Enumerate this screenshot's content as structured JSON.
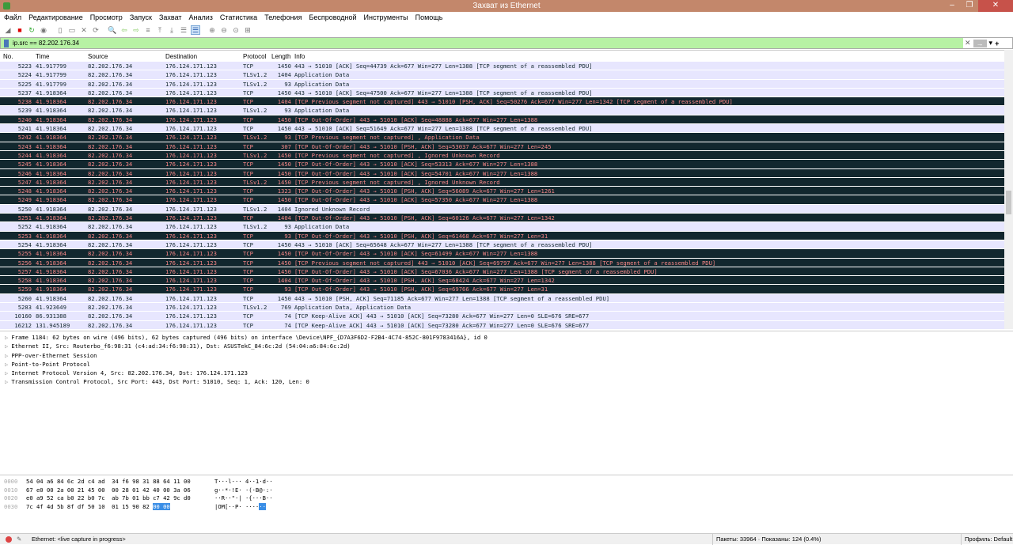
{
  "window": {
    "title": "Захват из Ethernet",
    "minimize": "–",
    "maximize": "❐",
    "close": "✕"
  },
  "menu": [
    "Файл",
    "Редактирование",
    "Просмотр",
    "Запуск",
    "Захват",
    "Анализ",
    "Статистика",
    "Телефония",
    "Беспроводной",
    "Инструменты",
    "Помощь"
  ],
  "toolbar": [
    "start-capture",
    "stop-capture",
    "restart-capture",
    "capture-options",
    "open-file",
    "save-file",
    "close-file",
    "reload-file",
    "find-packet",
    "go-back",
    "go-forward",
    "go-to-packet",
    "go-first",
    "go-last",
    "auto-scroll",
    "colorize",
    "zoom-in",
    "zoom-out",
    "zoom-normal",
    "resize-columns"
  ],
  "filter": {
    "value": "ip.src == 82.202.176.34",
    "clear": "✕",
    "apply": "→",
    "dropdown": "▾",
    "add": "+"
  },
  "columns": {
    "no": "No.",
    "time": "Time",
    "source": "Source",
    "destination": "Destination",
    "protocol": "Protocol",
    "length": "Length",
    "info": "Info"
  },
  "packets": [
    [
      "5223",
      "41.917799",
      "82.202.176.34",
      "176.124.171.123",
      "TCP",
      "1450",
      "443 → 51010 [ACK] Seq=44739 Ack=677 Win=277 Len=1388 [TCP segment of a reassembled PDU]",
      false
    ],
    [
      "5224",
      "41.917799",
      "82.202.176.34",
      "176.124.171.123",
      "TLSv1.2",
      "1404",
      "Application Data",
      false
    ],
    [
      "5225",
      "41.917799",
      "82.202.176.34",
      "176.124.171.123",
      "TLSv1.2",
      "93",
      "Application Data",
      false
    ],
    [
      "5237",
      "41.918364",
      "82.202.176.34",
      "176.124.171.123",
      "TCP",
      "1450",
      "443 → 51010 [ACK] Seq=47500 Ack=677 Win=277 Len=1388 [TCP segment of a reassembled PDU]",
      false
    ],
    [
      "5238",
      "41.918364",
      "82.202.176.34",
      "176.124.171.123",
      "TCP",
      "1404",
      "[TCP Previous segment not captured] 443 → 51010 [PSH, ACK] Seq=50276 Ack=677 Win=277 Len=1342 [TCP segment of a reassembled PDU]",
      true
    ],
    [
      "5239",
      "41.918364",
      "82.202.176.34",
      "176.124.171.123",
      "TLSv1.2",
      "93",
      "Application Data",
      false
    ],
    [
      "5240",
      "41.918364",
      "82.202.176.34",
      "176.124.171.123",
      "TCP",
      "1450",
      "[TCP Out-Of-Order] 443 → 51010 [ACK] Seq=48888 Ack=677 Win=277 Len=1388",
      true
    ],
    [
      "5241",
      "41.918364",
      "82.202.176.34",
      "176.124.171.123",
      "TCP",
      "1450",
      "443 → 51010 [ACK] Seq=51649 Ack=677 Win=277 Len=1388 [TCP segment of a reassembled PDU]",
      false
    ],
    [
      "5242",
      "41.918364",
      "82.202.176.34",
      "176.124.171.123",
      "TLSv1.2",
      "93",
      "[TCP Previous segment not captured] , Application Data",
      true
    ],
    [
      "5243",
      "41.918364",
      "82.202.176.34",
      "176.124.171.123",
      "TCP",
      "307",
      "[TCP Out-Of-Order] 443 → 51010 [PSH, ACK] Seq=53037 Ack=677 Win=277 Len=245",
      true
    ],
    [
      "5244",
      "41.918364",
      "82.202.176.34",
      "176.124.171.123",
      "TLSv1.2",
      "1450",
      "[TCP Previous segment not captured] , Ignored Unknown Record",
      true
    ],
    [
      "5245",
      "41.918364",
      "82.202.176.34",
      "176.124.171.123",
      "TCP",
      "1450",
      "[TCP Out-Of-Order] 443 → 51010 [ACK] Seq=53313 Ack=677 Win=277 Len=1388",
      true
    ],
    [
      "5246",
      "41.918364",
      "82.202.176.34",
      "176.124.171.123",
      "TCP",
      "1450",
      "[TCP Out-Of-Order] 443 → 51010 [ACK] Seq=54701 Ack=677 Win=277 Len=1388",
      true
    ],
    [
      "5247",
      "41.918364",
      "82.202.176.34",
      "176.124.171.123",
      "TLSv1.2",
      "1450",
      "[TCP Previous segment not captured] , Ignored Unknown Record",
      true
    ],
    [
      "5248",
      "41.918364",
      "82.202.176.34",
      "176.124.171.123",
      "TCP",
      "1323",
      "[TCP Out-Of-Order] 443 → 51010 [PSH, ACK] Seq=56089 Ack=677 Win=277 Len=1261",
      true
    ],
    [
      "5249",
      "41.918364",
      "82.202.176.34",
      "176.124.171.123",
      "TCP",
      "1450",
      "[TCP Out-Of-Order] 443 → 51010 [ACK] Seq=57350 Ack=677 Win=277 Len=1388",
      true
    ],
    [
      "5250",
      "41.918364",
      "82.202.176.34",
      "176.124.171.123",
      "TLSv1.2",
      "1404",
      "Ignored Unknown Record",
      false
    ],
    [
      "5251",
      "41.918364",
      "82.202.176.34",
      "176.124.171.123",
      "TCP",
      "1404",
      "[TCP Out-Of-Order] 443 → 51010 [PSH, ACK] Seq=60126 Ack=677 Win=277 Len=1342",
      true
    ],
    [
      "5252",
      "41.918364",
      "82.202.176.34",
      "176.124.171.123",
      "TLSv1.2",
      "93",
      "Application Data",
      false
    ],
    [
      "5253",
      "41.918364",
      "82.202.176.34",
      "176.124.171.123",
      "TCP",
      "93",
      "[TCP Out-Of-Order] 443 → 51010 [PSH, ACK] Seq=61468 Ack=677 Win=277 Len=31",
      true
    ],
    [
      "5254",
      "41.918364",
      "82.202.176.34",
      "176.124.171.123",
      "TCP",
      "1450",
      "443 → 51010 [ACK] Seq=65648 Ack=677 Win=277 Len=1388 [TCP segment of a reassembled PDU]",
      false
    ],
    [
      "5255",
      "41.918364",
      "82.202.176.34",
      "176.124.171.123",
      "TCP",
      "1450",
      "[TCP Out-Of-Order] 443 → 51010 [ACK] Seq=61499 Ack=677 Win=277 Len=1388",
      true
    ],
    [
      "5256",
      "41.918364",
      "82.202.176.34",
      "176.124.171.123",
      "TCP",
      "1450",
      "[TCP Previous segment not captured] 443 → 51010 [ACK] Seq=69797 Ack=677 Win=277 Len=1388 [TCP segment of a reassembled PDU]",
      true
    ],
    [
      "5257",
      "41.918364",
      "82.202.176.34",
      "176.124.171.123",
      "TCP",
      "1450",
      "[TCP Out-Of-Order] 443 → 51010 [ACK] Seq=67036 Ack=677 Win=277 Len=1388 [TCP segment of a reassembled PDU]",
      true
    ],
    [
      "5258",
      "41.918364",
      "82.202.176.34",
      "176.124.171.123",
      "TCP",
      "1404",
      "[TCP Out-Of-Order] 443 → 51010 [PSH, ACK] Seq=68424 Ack=677 Win=277 Len=1342",
      true
    ],
    [
      "5259",
      "41.918364",
      "82.202.176.34",
      "176.124.171.123",
      "TCP",
      "93",
      "[TCP Out-Of-Order] 443 → 51010 [PSH, ACK] Seq=69766 Ack=677 Win=277 Len=31",
      true
    ],
    [
      "5260",
      "41.918364",
      "82.202.176.34",
      "176.124.171.123",
      "TCP",
      "1450",
      "443 → 51010 [PSH, ACK] Seq=71185 Ack=677 Win=277 Len=1388 [TCP segment of a reassembled PDU]",
      false
    ],
    [
      "5283",
      "41.923649",
      "82.202.176.34",
      "176.124.171.123",
      "TLSv1.2",
      "769",
      "Application Data, Application Data",
      false
    ],
    [
      "10160",
      "86.931388",
      "82.202.176.34",
      "176.124.171.123",
      "TCP",
      "74",
      "[TCP Keep-Alive ACK] 443 → 51010 [ACK] Seq=73280 Ack=677 Win=277 Len=0 SLE=676 SRE=677",
      false
    ],
    [
      "16212",
      "131.945189",
      "82.202.176.34",
      "176.124.171.123",
      "TCP",
      "74",
      "[TCP Keep-Alive ACK] 443 → 51010 [ACK] Seq=73280 Ack=677 Win=277 Len=0 SLE=676 SRE=677",
      false
    ]
  ],
  "details": [
    "Frame 1184: 62 bytes on wire (496 bits), 62 bytes captured (496 bits) on interface \\Device\\NPF_{D7A3F6D2-F2B4-4C74-852C-801F9783416A}, id 0",
    "Ethernet II, Src: Routerbo_f6:98:31 (c4:ad:34:f6:98:31), Dst: ASUSTekC_84:6c:2d (54:04:a6:84:6c:2d)",
    "PPP-over-Ethernet Session",
    "Point-to-Point Protocol",
    "Internet Protocol Version 4, Src: 82.202.176.34, Dst: 176.124.171.123",
    "Transmission Control Protocol, Src Port: 443, Dst Port: 51010, Seq: 1, Ack: 120, Len: 0"
  ],
  "hex": [
    {
      "offset": "0000",
      "bytes": "54 04 a6 84 6c 2d c4 ad  34 f6 98 31 88 64 11 00",
      "hl": "",
      "ascii": "T···l-·· 4··1·d··",
      "ahl": ""
    },
    {
      "offset": "0010",
      "bytes": "67 e0 00 2a 00 21 45 00  00 28 01 42 40 00 3a 06",
      "hl": "",
      "ascii": "g··*·!E· ·(·B@·:·",
      "ahl": ""
    },
    {
      "offset": "0020",
      "bytes": "e0 a9 52 ca b0 22 b0 7c  ab 7b 01 bb c7 42 9c d0",
      "hl": "",
      "ascii": "··R··\"·| ·{···B··",
      "ahl": ""
    },
    {
      "offset": "0030",
      "bytes": "7c 4f 4d 5b 8f df 50 10  01 15 90 82 ",
      "hl": "00 00",
      "ascii": "|OM[··P· ····",
      "ahl": "··"
    }
  ],
  "status": {
    "interface": "Ethernet: <live capture in progress>",
    "packets": "Пакеты: 33964 · Показаны: 124 (0.4%)",
    "profile": "Профиль: Default"
  }
}
